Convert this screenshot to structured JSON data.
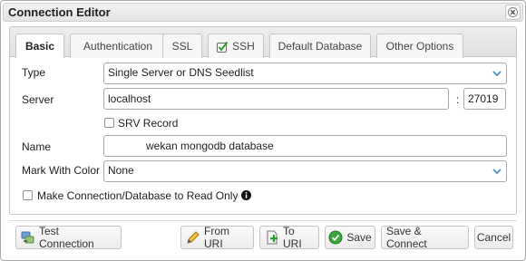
{
  "window": {
    "title": "Connection Editor",
    "close_icon": "close-icon"
  },
  "tabs": [
    {
      "label": "Basic",
      "active": true
    },
    {
      "label": "Authentication",
      "active": false
    },
    {
      "label": "SSL",
      "active": false
    },
    {
      "label": "SSH",
      "active": false,
      "icon": "check-icon"
    },
    {
      "label": "Default Database",
      "active": false
    },
    {
      "label": "Other Options",
      "active": false
    }
  ],
  "form": {
    "type": {
      "label": "Type",
      "value": "Single Server or DNS Seedlist"
    },
    "server": {
      "label": "Server",
      "host": "localhost",
      "separator": ":",
      "port": "27019"
    },
    "srv_record": {
      "label": "SRV Record",
      "checked": false
    },
    "name": {
      "label": "Name",
      "value": "wekan mongodb database"
    },
    "mark_color": {
      "label": "Mark With Color",
      "value": "None"
    },
    "read_only": {
      "label": "Make Connection/Database to Read Only",
      "checked": false,
      "info_icon": "info-icon"
    }
  },
  "footer": {
    "test_connection": "Test Connection",
    "from_uri": "From URI",
    "to_uri": "To URI",
    "save": "Save",
    "save_connect": "Save & Connect",
    "cancel": "Cancel"
  },
  "colors": {
    "accent_blue": "#4a8fc6",
    "border": "#c5c5c5",
    "ssh_check_green": "#2e9b2e"
  }
}
